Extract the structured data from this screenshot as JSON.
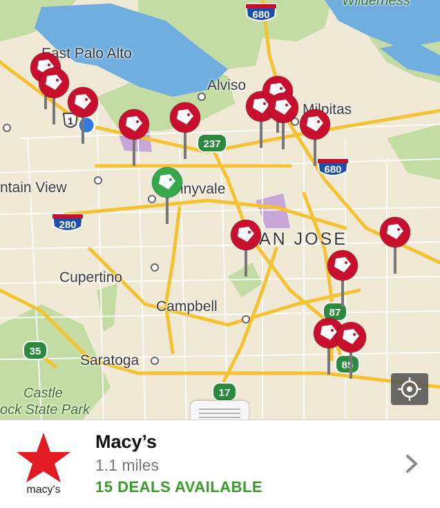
{
  "map": {
    "places": [
      {
        "name": "East Palo Alto"
      },
      {
        "name": "Alviso"
      },
      {
        "name": "Milpitas"
      },
      {
        "name": "ntain View"
      },
      {
        "name": "nnyvale"
      },
      {
        "name": "AN JOSE"
      },
      {
        "name": "Cupertino"
      },
      {
        "name": "Campbell"
      },
      {
        "name": "Saratoga"
      },
      {
        "name": "Castle"
      },
      {
        "name": "ock State Park"
      },
      {
        "name": "Wilderness"
      }
    ],
    "highway_shields": {
      "i680_top": "680",
      "i680_mid": "680",
      "i280": "280",
      "ca237": "237",
      "ca87": "87",
      "ca85": "85",
      "ca35": "35",
      "ca17": "17",
      "us101": "1"
    },
    "colors": {
      "land": "#efe9d6",
      "water": "#70aee0",
      "park": "#c3dca3",
      "highway": "#f6c232",
      "pin_red": "#c8102e",
      "pin_green": "#35a84a"
    }
  },
  "card": {
    "store_name": "Macy’s",
    "distance": "1.1 miles",
    "deals": "15 DEALS AVAILABLE",
    "logo_text": "macy's"
  }
}
